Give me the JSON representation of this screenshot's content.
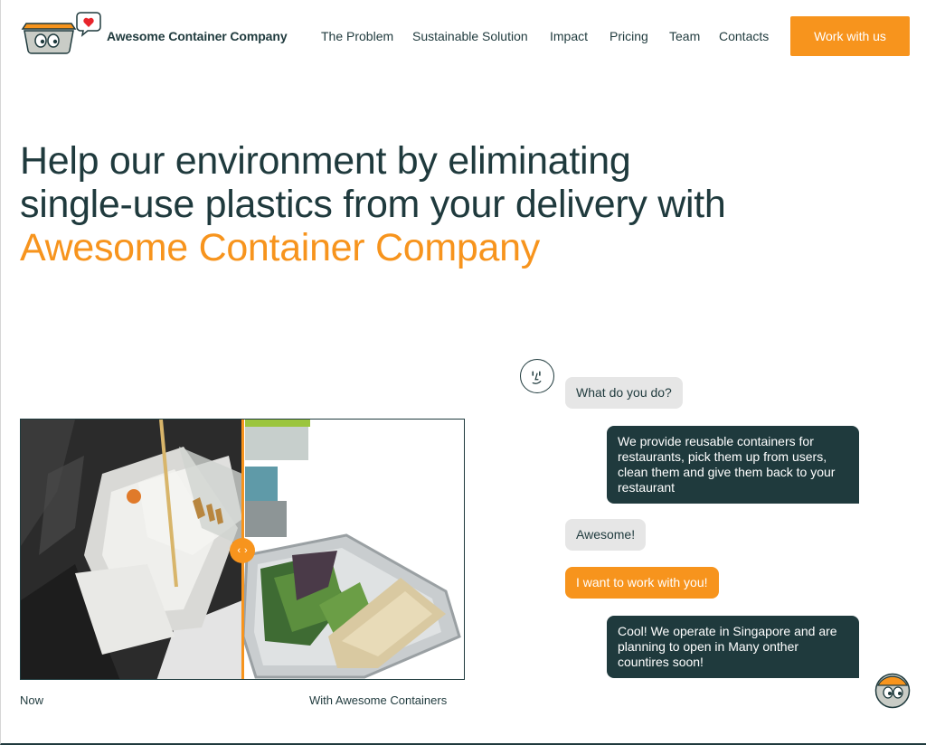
{
  "header": {
    "brand": "Awesome Container Company",
    "nav": [
      {
        "label": "The Problem",
        "id": "the-problem"
      },
      {
        "label": "Sustainable Solution",
        "id": "sustainable-solution"
      },
      {
        "label": "Impact",
        "id": "impact"
      },
      {
        "label": "Pricing",
        "id": "pricing"
      },
      {
        "label": "Team",
        "id": "team"
      },
      {
        "label": "Contacts",
        "id": "contacts"
      }
    ],
    "cta": "Work with us"
  },
  "hero": {
    "line1": "Help our environment by eliminating",
    "line2": "single-use plastics from your delivery with",
    "accent": "Awesome Container Company"
  },
  "comparison": {
    "left_caption": "Now",
    "right_caption": "With Awesome Containers",
    "position": 0.5
  },
  "chat": [
    {
      "from": "user",
      "text": "What do you do?"
    },
    {
      "from": "company",
      "text": "We provide reusable containers for restaurants, pick them up from users, clean them and give them back to your restaurant"
    },
    {
      "from": "user",
      "text": "Awesome!"
    },
    {
      "from": "user",
      "text": "I want to work with you!",
      "highlight": true
    },
    {
      "from": "company",
      "text": "Cool! We operate in Singapore and are planning to open in Many onther countires soon!"
    }
  ],
  "colors": {
    "accent": "#f7941d",
    "dark": "#1f3a3d",
    "bubble_grey": "#e6e6e6"
  },
  "icons": {
    "logo": "container-mascot-heart-icon",
    "chat_user": "face-avatar-icon",
    "chat_company": "container-mascot-icon",
    "handle": "chevron-left-right-icon"
  }
}
